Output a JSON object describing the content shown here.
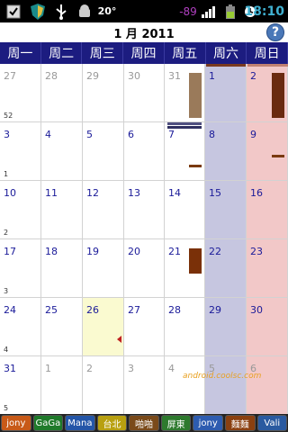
{
  "status_bar": {
    "temperature": "20°",
    "signal_strength": "-89",
    "time": "18:10",
    "icons": [
      "checkbox-icon",
      "shield-icon",
      "usb-icon",
      "android-icon",
      "signal-icon",
      "battery-icon",
      "alarm-icon"
    ]
  },
  "header": {
    "title": "1 月 2011",
    "help_label": "?"
  },
  "weekdays": [
    "周一",
    "周二",
    "周三",
    "周四",
    "周五",
    "周六",
    "周日"
  ],
  "weeks": [
    {
      "week_number": "52",
      "days": [
        "27",
        "28",
        "29",
        "30",
        "31",
        "1",
        "2"
      ],
      "in_month": [
        false,
        false,
        false,
        false,
        false,
        true,
        true
      ]
    },
    {
      "week_number": "1",
      "days": [
        "3",
        "4",
        "5",
        "6",
        "7",
        "8",
        "9"
      ],
      "in_month": [
        true,
        true,
        true,
        true,
        true,
        true,
        true
      ]
    },
    {
      "week_number": "2",
      "days": [
        "10",
        "11",
        "12",
        "13",
        "14",
        "15",
        "16"
      ],
      "in_month": [
        true,
        true,
        true,
        true,
        true,
        true,
        true
      ]
    },
    {
      "week_number": "3",
      "days": [
        "17",
        "18",
        "19",
        "20",
        "21",
        "22",
        "23"
      ],
      "in_month": [
        true,
        true,
        true,
        true,
        true,
        true,
        true
      ]
    },
    {
      "week_number": "4",
      "days": [
        "24",
        "25",
        "26",
        "27",
        "28",
        "29",
        "30"
      ],
      "in_month": [
        true,
        true,
        true,
        true,
        true,
        true,
        true
      ]
    },
    {
      "week_number": "5",
      "days": [
        "31",
        "1",
        "2",
        "3",
        "4",
        "5",
        "6"
      ],
      "in_month": [
        true,
        false,
        false,
        false,
        false,
        false,
        false
      ]
    }
  ],
  "today": "26",
  "watermark": "android.coolsc.com",
  "calendars": [
    {
      "label": "jony",
      "color": "#c85a18"
    },
    {
      "label": "GaGa",
      "color": "#1f7a2a"
    },
    {
      "label": "Mana",
      "color": "#2456a8"
    },
    {
      "label": "台北",
      "color": "#b8a010"
    },
    {
      "label": "啪啪",
      "color": "#7a4a1a"
    },
    {
      "label": "屏東",
      "color": "#2e7a2e"
    },
    {
      "label": "jony",
      "color": "#2d5cb0"
    },
    {
      "label": "麵麵",
      "color": "#8a4010"
    },
    {
      "label": "Vali",
      "color": "#2a5aa0"
    }
  ],
  "colors": {
    "header_bg": "#1c1c80",
    "saturday_bg": "#c6c6e0",
    "sunday_bg": "#f2c8c8",
    "today_bg": "#fafad0",
    "day_text": "#1a1a99",
    "other_month_text": "#999999"
  }
}
